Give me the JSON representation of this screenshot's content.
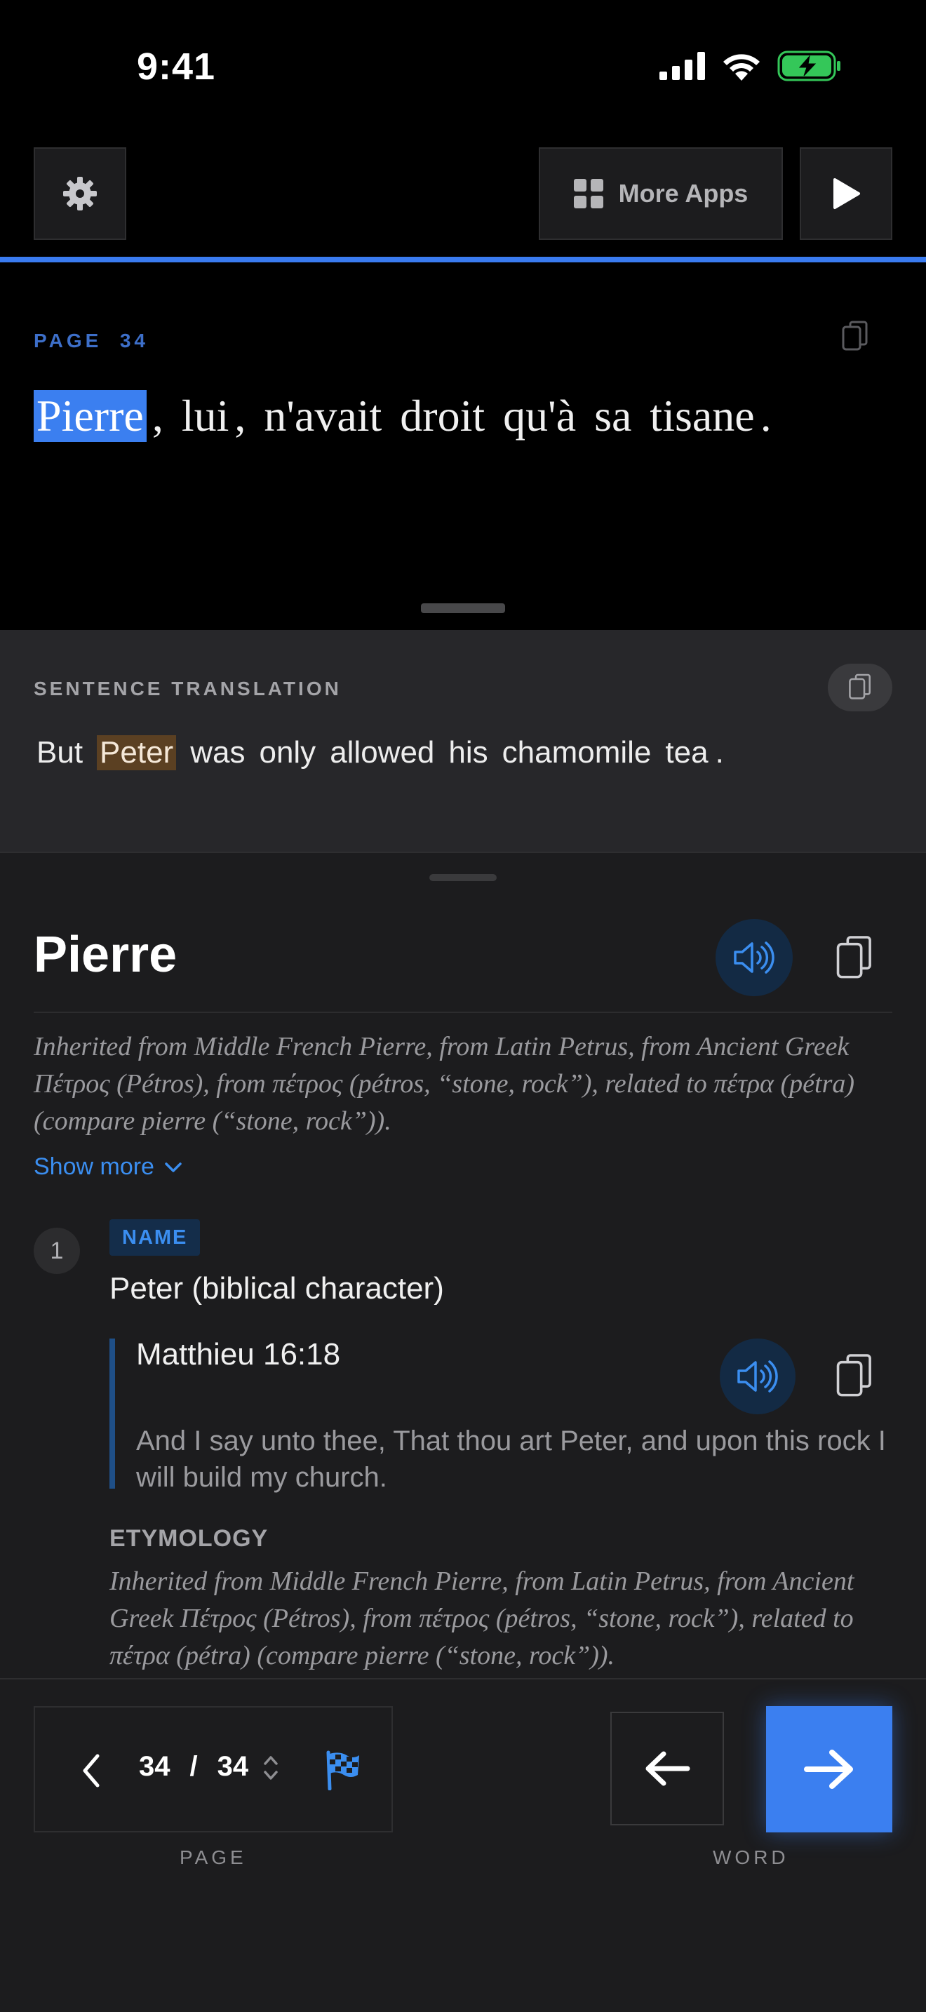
{
  "status": {
    "time": "9:41"
  },
  "toolbar": {
    "more_apps_label": "More Apps"
  },
  "reader": {
    "page_label": "PAGE",
    "page_number": "34",
    "sentence": [
      {
        "text": "Pierre",
        "highlight": true
      },
      {
        "text": ",",
        "punct": true
      },
      {
        "text": "lui"
      },
      {
        "text": ",",
        "punct": true
      },
      {
        "text": "n'avait"
      },
      {
        "text": "droit"
      },
      {
        "text": "qu'à"
      },
      {
        "text": "sa"
      },
      {
        "text": "tisane"
      },
      {
        "text": ".",
        "punct": true
      }
    ]
  },
  "translation": {
    "label": "SENTENCE TRANSLATION",
    "sentence": [
      {
        "text": "But"
      },
      {
        "text": "Peter",
        "highlight": true
      },
      {
        "text": "was"
      },
      {
        "text": "only"
      },
      {
        "text": "allowed"
      },
      {
        "text": "his"
      },
      {
        "text": "chamomile"
      },
      {
        "text": "tea"
      },
      {
        "text": ".",
        "punct": true
      }
    ]
  },
  "dictionary": {
    "headword": "Pierre",
    "etymology": "Inherited from Middle French Pierre, from Latin Petrus, from Ancient Greek Πέτρος (Pétros), from πέτρος (pétros, “stone, rock”), related to πέτρα (pétra) (compare pierre (“stone, rock”)).",
    "show_more": "Show more",
    "sense": {
      "number": "1",
      "pos": "NAME",
      "gloss": "Peter (biblical character)",
      "quote_ref": "Matthieu 16:18",
      "quote_text": "And I say unto thee, That thou art Peter, and upon this rock I will build my church.",
      "etymology_label": "ETYMOLOGY",
      "etymology": "Inherited from Middle French Pierre, from Latin Petrus, from Ancient Greek Πέτρος (Pétros), from πέτρος (pétros, “stone, rock”), related to πέτρα (pétra) (compare pierre (“stone, rock”))."
    }
  },
  "bottom": {
    "page_current": "34",
    "page_separator": "/",
    "page_total": "34",
    "page_label": "PAGE",
    "word_label": "WORD"
  },
  "colors": {
    "accent": "#3b7ff0",
    "link": "#3b8ef0",
    "translation_highlight": "#5b4022",
    "battery": "#34c759"
  }
}
